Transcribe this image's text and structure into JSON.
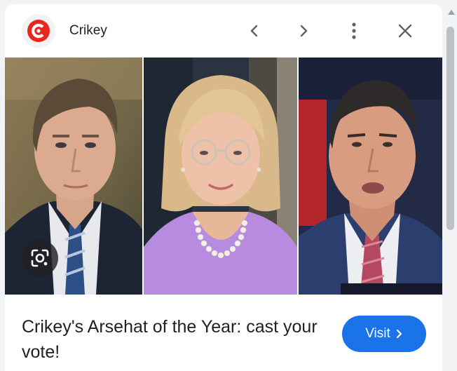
{
  "header": {
    "source_name": "Crikey",
    "logo_icon": "crikey-logo",
    "logo_color": "#e8271f",
    "prev_icon": "chevron-left-icon",
    "next_icon": "chevron-right-icon",
    "more_icon": "more-vert-icon",
    "close_icon": "close-icon"
  },
  "images": {
    "photos": [
      {
        "subject": "man-in-suit-blue-tie"
      },
      {
        "subject": "woman-in-lilac-pearls"
      },
      {
        "subject": "man-in-suit-pink-tie"
      }
    ],
    "lens_icon": "google-lens-icon"
  },
  "footer": {
    "title": "Crikey's Arsehat of the Year: cast your vote!",
    "visit_label": "Visit",
    "visit_icon": "chevron-right-icon",
    "accent": "#1a73e8"
  }
}
